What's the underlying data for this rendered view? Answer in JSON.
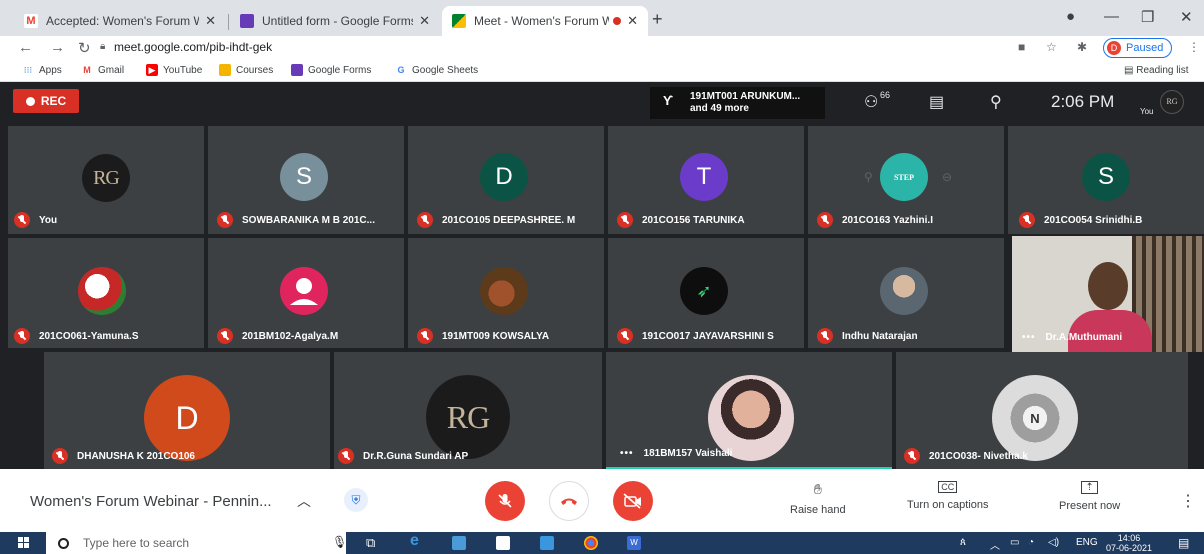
{
  "browser": {
    "tabs": [
      {
        "title": "Accepted: Women's Forum Webi",
        "favicon": "gmail-icon"
      },
      {
        "title": "Untitled form - Google Forms",
        "favicon": "google-forms-icon"
      },
      {
        "title": "Meet - Women's Forum Wel",
        "favicon": "google-meet-icon"
      }
    ],
    "url": "meet.google.com/pib-ihdt-gek",
    "profile_letter": "D",
    "profile_status": "Paused",
    "bookmarks": [
      "Apps",
      "Gmail",
      "YouTube",
      "Courses",
      "Google Forms",
      "Google Sheets"
    ],
    "reading_list": "Reading list"
  },
  "meet": {
    "rec_label": "REC",
    "presenter": {
      "line1": "191MT001 ARUNKUM...",
      "line2": "and 49 more"
    },
    "people_count": "66",
    "time": "2:06 PM",
    "you_label": "You",
    "you_avatar": "RG",
    "participants": [
      {
        "name": "You",
        "avatar": "RG"
      },
      {
        "name": "SOWBARANIKA M B 201C...",
        "avatar": "S",
        "color": "#78909c"
      },
      {
        "name": "201CO105 DEEPASHREE. M",
        "avatar": "D",
        "color": "#0b5345"
      },
      {
        "name": "201CO156 TARUNIKA",
        "avatar": "T",
        "color": "#6a3cc9"
      },
      {
        "name": "201CO163 Yazhini.I",
        "avatar": "STEP"
      },
      {
        "name": "201CO054 Srinidhi.B",
        "avatar": "S",
        "color": "#0b5345"
      },
      {
        "name": "201CO061-Yamuna.S"
      },
      {
        "name": "201BM102-Agalya.M"
      },
      {
        "name": "191MT009 KOWSALYA"
      },
      {
        "name": "191CO017 JAYAVARSHINI S"
      },
      {
        "name": "Indhu Natarajan"
      },
      {
        "name": "Dr.A.Muthumani"
      },
      {
        "name": "DHANUSHA K 201CO106",
        "avatar": "D",
        "color": "#d14a1c"
      },
      {
        "name": "Dr.R.Guna Sundari AP",
        "avatar": "RG"
      },
      {
        "name": "181BM157 Vaishali"
      },
      {
        "name": "201CO038- Nivetha.k"
      }
    ],
    "meeting_title": "Women's Forum Webinar - Pennin...",
    "raise_hand": "Raise hand",
    "captions": "Turn on captions",
    "present_now": "Present now"
  },
  "taskbar": {
    "search_placeholder": "Type here to search",
    "lang": "ENG",
    "time": "14:06",
    "date": "07-06-2021"
  }
}
